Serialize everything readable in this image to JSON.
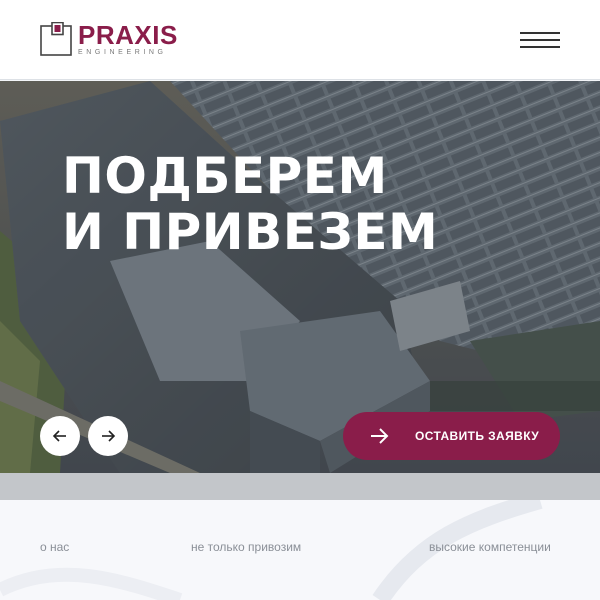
{
  "header": {
    "logo": {
      "name": "PRAXIS",
      "sub": "ENGINEERING"
    },
    "menu_icon": "hamburger-icon"
  },
  "hero": {
    "title_line1": "ПОДБЕРЕМ",
    "title_line2": "И ПРИВЕЗЕМ",
    "prev_icon": "arrow-left-icon",
    "next_icon": "arrow-right-icon",
    "cta": {
      "label": "ОСТАВИТЬ ЗАЯВКУ",
      "icon": "arrow-right-icon"
    }
  },
  "nav": {
    "links": [
      "о нас",
      "не только привозим",
      "высокие компетенции"
    ]
  },
  "colors": {
    "brand": "#8a1d4a",
    "header_bg": "#ffffff",
    "text_muted": "#8a8f97"
  }
}
